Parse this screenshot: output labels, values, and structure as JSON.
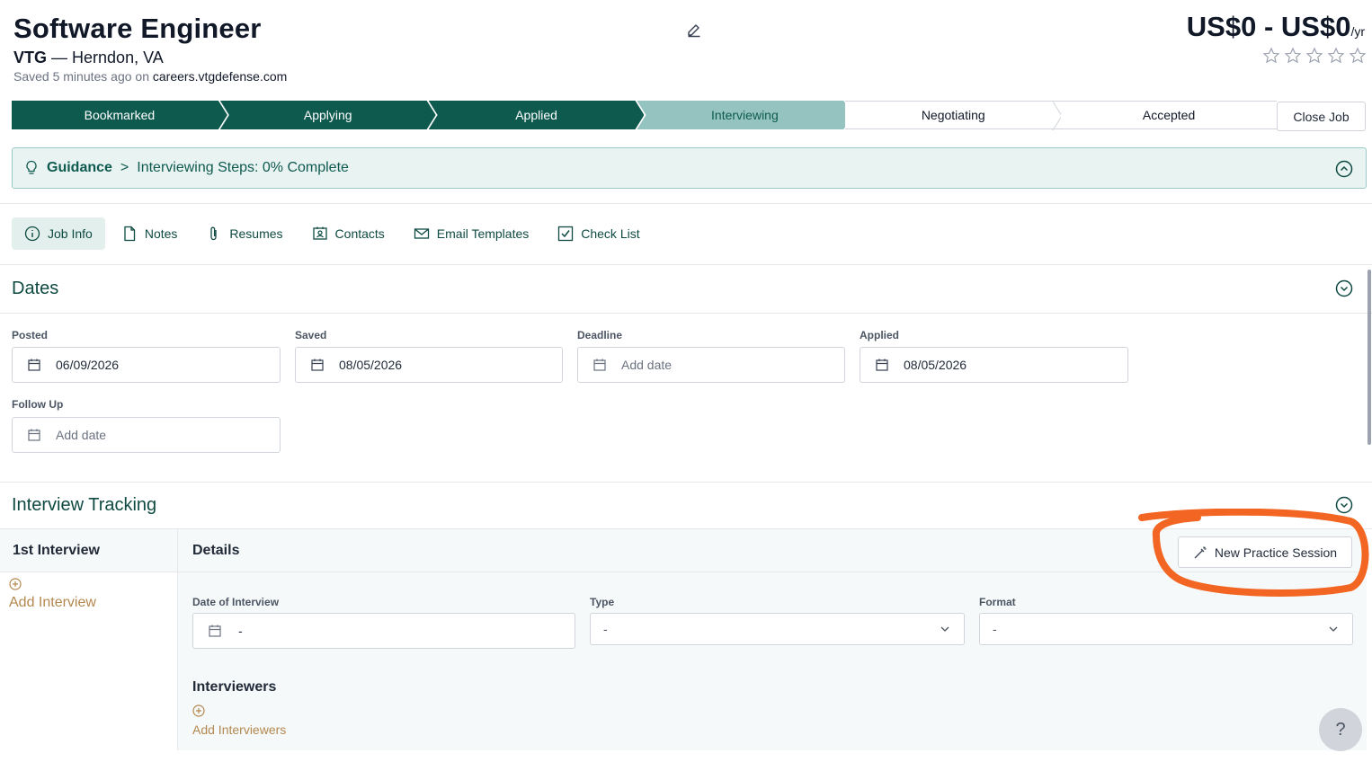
{
  "header": {
    "title": "Software Engineer",
    "company": "VTG",
    "location_sep": " — ",
    "location": "Herndon, VA",
    "saved_prefix": "Saved 5 minutes ago on ",
    "saved_source": "careers.vtgdefense.com",
    "salary": "US$0 - US$0",
    "salary_unit": "/yr",
    "rating_stars": 0,
    "rating_max": 5
  },
  "pipeline": {
    "stages": [
      "Bookmarked",
      "Applying",
      "Applied",
      "Interviewing",
      "Negotiating",
      "Accepted"
    ],
    "current": "Interviewing",
    "close_label": "Close Job"
  },
  "guidance": {
    "label": "Guidance",
    "separator": ">",
    "text": "Interviewing Steps: 0% Complete"
  },
  "tabs": [
    "Job Info",
    "Notes",
    "Resumes",
    "Contacts",
    "Email Templates",
    "Check List"
  ],
  "dates": {
    "title": "Dates",
    "fields": [
      {
        "label": "Posted",
        "value": "06/09/2026"
      },
      {
        "label": "Saved",
        "value": "08/05/2026"
      },
      {
        "label": "Deadline",
        "value": "Add date"
      },
      {
        "label": "Applied",
        "value": "08/05/2026"
      },
      {
        "label": "Follow Up",
        "value": "Add date"
      }
    ]
  },
  "interview": {
    "title": "Interview Tracking",
    "first_label": "1st Interview",
    "add_interview": "Add Interview",
    "details_label": "Details",
    "practice_button": "New Practice Session",
    "date_label": "Date of Interview",
    "date_value": "-",
    "type_label": "Type",
    "type_value": "-",
    "format_label": "Format",
    "format_value": "-",
    "interviewers_label": "Interviewers",
    "add_interviewers": "Add Interviewers"
  },
  "help_label": "?",
  "colors": {
    "brand": "#0e5a4f",
    "current_stage": "#94c3c0",
    "accent_link": "#b3884f",
    "annotation": "#f26522"
  }
}
